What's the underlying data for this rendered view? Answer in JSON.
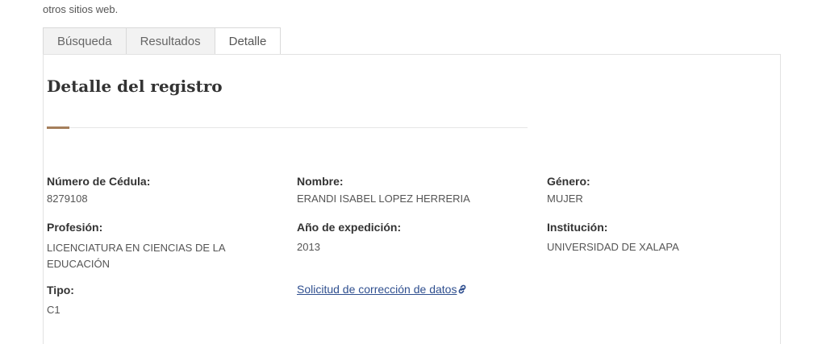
{
  "intro": {
    "line2": "otros sitios web."
  },
  "tabs": [
    "Búsqueda",
    "Resultados",
    "Detalle"
  ],
  "title": "Detalle del registro",
  "fields": {
    "cedula": {
      "label": "Número de Cédula:",
      "value": "8279108"
    },
    "nombre": {
      "label": "Nombre:",
      "value": "ERANDI ISABEL LOPEZ HERRERIA"
    },
    "genero": {
      "label": "Género:",
      "value": "MUJER"
    },
    "profesion": {
      "label": "Profesión:",
      "value_line1": "LICENCIATURA EN CIENCIAS DE LA",
      "value_line2": "EDUCACIÓN"
    },
    "anio": {
      "label": "Año de expedición:",
      "value": "2013"
    },
    "institucion": {
      "label": "Institución:",
      "value": "UNIVERSIDAD DE XALAPA"
    },
    "tipo": {
      "label": "Tipo:",
      "value": "C1"
    }
  },
  "correction_link": "Solicitud de corrección de datos",
  "icons": {
    "link": "link-icon"
  }
}
